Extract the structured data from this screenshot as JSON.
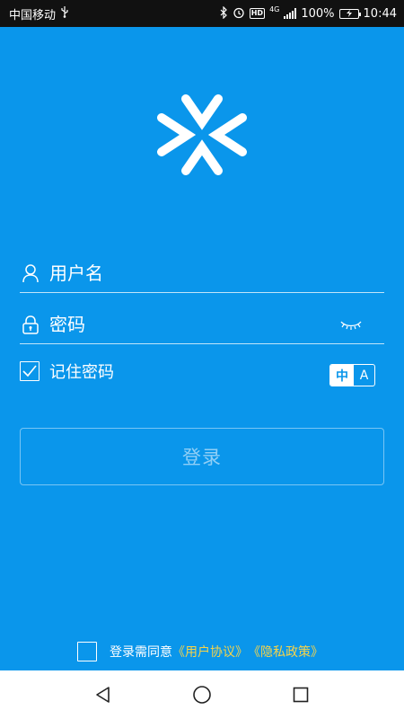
{
  "status_bar": {
    "carrier": "中国移动",
    "usb_icon": "usb-icon",
    "hd_badge": "HD",
    "network_type": "4G",
    "battery_percent": "100%",
    "time": "10:44"
  },
  "logo": {
    "icon": "app-logo-icon"
  },
  "form": {
    "username_placeholder": "用户名",
    "password_placeholder": "密码",
    "remember_label": "记住密码",
    "remember_checked": true,
    "ime_zh": "中",
    "ime_en": "A",
    "login_label": "登录"
  },
  "agreement": {
    "prefix": "登录需同意",
    "user_agreement": "《用户协议》",
    "privacy_policy": "《隐私政策》"
  },
  "colors": {
    "background": "#0a96eb",
    "link": "#f5d34a",
    "status_bar": "#111111",
    "nav_bar": "#ffffff"
  },
  "nav_bar": {
    "back_icon": "back-triangle-icon",
    "home_icon": "home-circle-icon",
    "recents_icon": "recents-square-icon"
  }
}
